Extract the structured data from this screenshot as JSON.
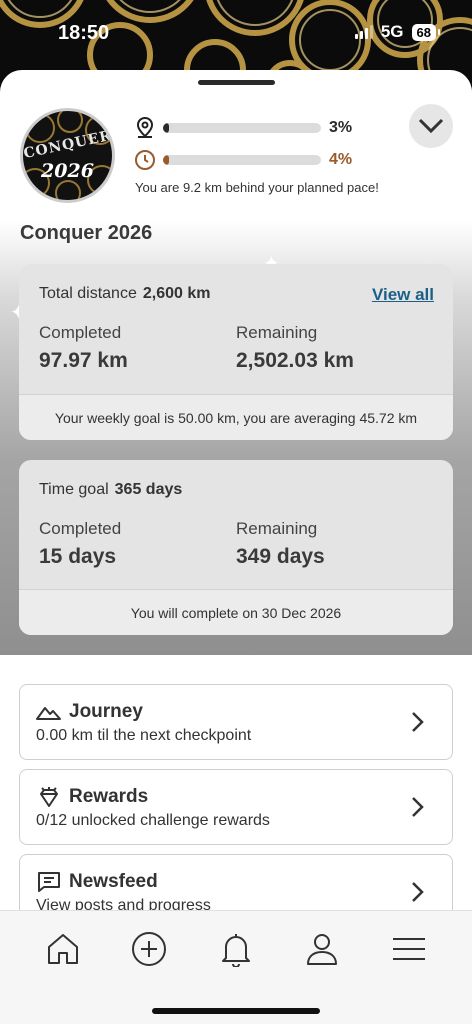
{
  "status_bar": {
    "time": "18:50",
    "network": "5G",
    "battery": "68"
  },
  "header": {
    "badge": {
      "line1": "CONQUER",
      "line2": "2026"
    },
    "distance_progress": {
      "percent_label": "3%",
      "fraction": 0.03,
      "color": "#2b2b2b",
      "icon": "location-pin-icon"
    },
    "time_progress": {
      "percent_label": "4%",
      "fraction": 0.04,
      "color": "#9a5a2c",
      "icon": "clock-icon"
    },
    "pace_message": "You are 9.2 km behind your planned pace!",
    "collapse_icon": "chevron-down-icon"
  },
  "challenge": {
    "title": "Conquer 2026"
  },
  "distance_card": {
    "label": "Total distance",
    "value": "2,600 km",
    "link": "View all",
    "completed_label": "Completed",
    "completed_value": "97.97 km",
    "remaining_label": "Remaining",
    "remaining_value": "2,502.03 km",
    "footer": "Your weekly goal is 50.00 km, you are averaging 45.72 km"
  },
  "time_card": {
    "label": "Time goal",
    "value": "365 days",
    "completed_label": "Completed",
    "completed_value": "15 days",
    "remaining_label": "Remaining",
    "remaining_value": "349 days",
    "footer": "You will complete on 30 Dec 2026"
  },
  "list": [
    {
      "title": "Journey",
      "subtitle": "0.00 km til the next checkpoint",
      "icon": "mountain-icon"
    },
    {
      "title": "Rewards",
      "subtitle": "0/12 unlocked challenge rewards",
      "icon": "diamond-icon"
    },
    {
      "title": "Newsfeed",
      "subtitle": "View posts and progress",
      "icon": "message-icon"
    }
  ],
  "tabbar": [
    "home-icon",
    "add-circle-icon",
    "bell-icon",
    "profile-icon",
    "menu-icon"
  ],
  "colors": {
    "link": "#1d5f86",
    "time_accent": "#9a5a2c",
    "gold": "#c9a24a"
  }
}
